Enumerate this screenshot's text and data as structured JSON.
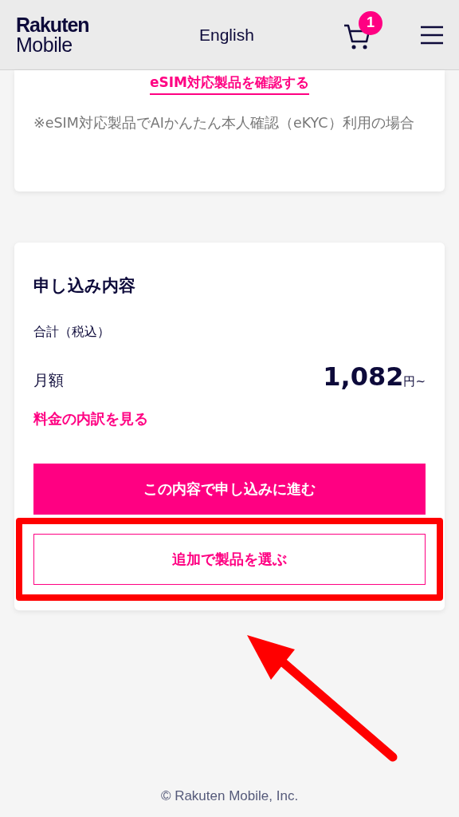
{
  "header": {
    "logo_top": "Rakuten",
    "logo_bottom": "Mobile",
    "language": "English",
    "cart_count": "1"
  },
  "esim_card": {
    "link": "eSIM対応製品を確認する",
    "note": "※eSIM対応製品でAIかんたん本人確認（eKYC）利用の場合"
  },
  "summary": {
    "title": "申し込み内容",
    "total_label": "合計（税込）",
    "monthly_label": "月額",
    "price": "1,082",
    "price_unit": "円~",
    "breakdown_link": "料金の内訳を見る",
    "buttons": [
      {
        "label": "この内容で申し込みに進む",
        "kind": "primary",
        "highlighted": false
      },
      {
        "label": "追加で製品を選ぶ",
        "kind": "secondary",
        "highlighted": true
      }
    ]
  },
  "footer": "© Rakuten Mobile, Inc."
}
